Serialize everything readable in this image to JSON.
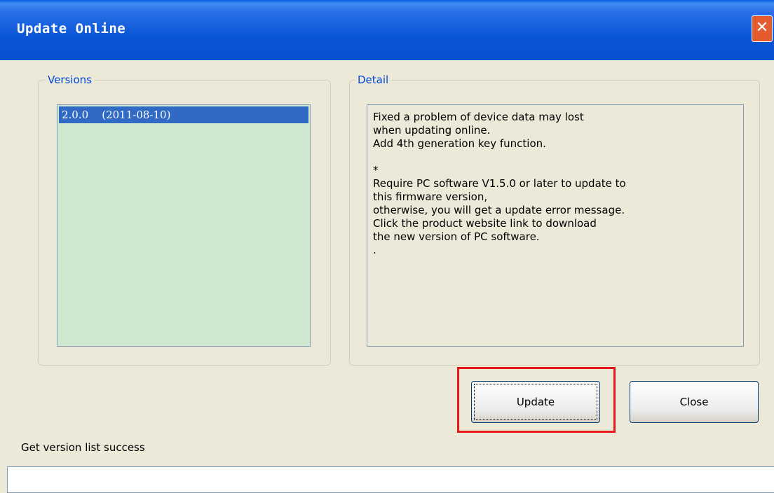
{
  "window": {
    "title": "Update Online",
    "close_label": "✕"
  },
  "versions": {
    "legend": "Versions",
    "items": [
      "2.0.0    (2011-08-10)"
    ],
    "selected_index": 0
  },
  "detail": {
    "legend": "Detail",
    "text": "Fixed a problem of device data may lost\nwhen updating online.\nAdd 4th generation key function.\n\n*\nRequire PC software V1.5.0 or later to update to\nthis firmware version,\notherwise, you will get a update error message.\nClick the product website link to download\nthe new version of PC software.\n."
  },
  "buttons": {
    "update_label": "Update",
    "close_label": "Close"
  },
  "status": {
    "text": "Get version list success",
    "progress": 0
  },
  "colors": {
    "titlebar": "#0a56d6",
    "highlight": "#e41a1a",
    "list_background": "#cfe8cf",
    "selection": "#316ac5"
  }
}
